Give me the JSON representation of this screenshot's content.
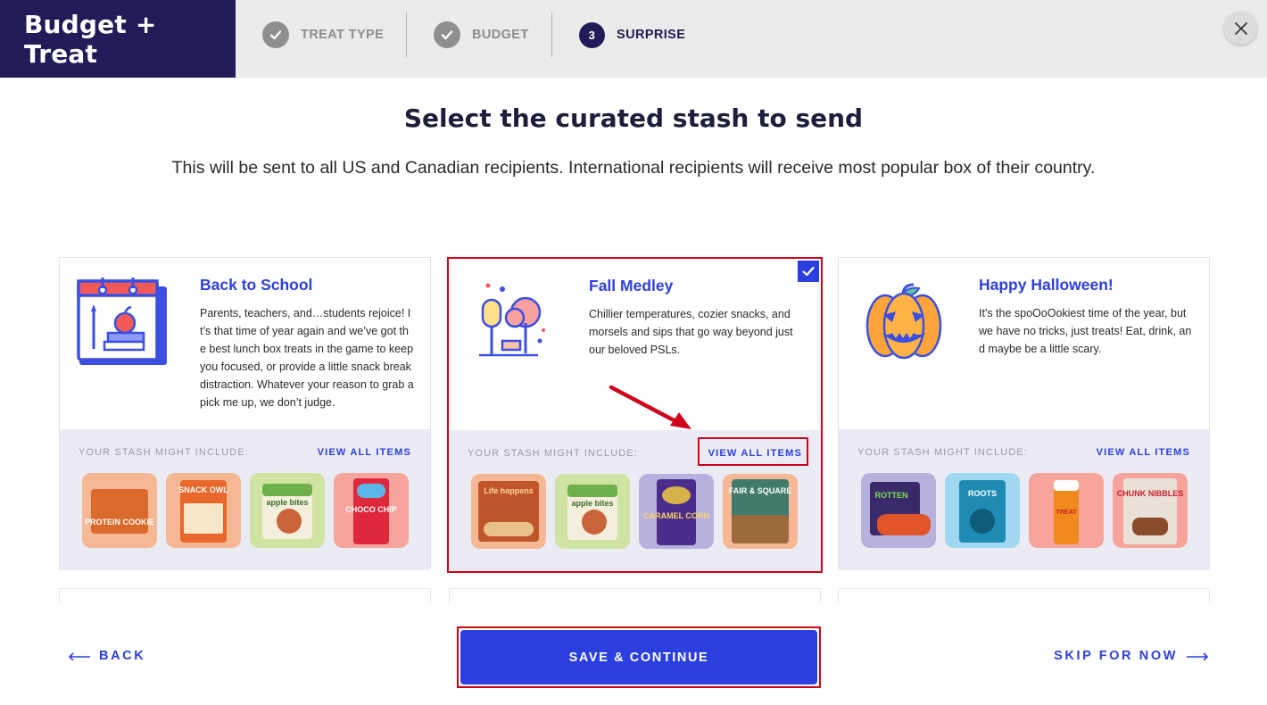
{
  "header": {
    "brand": "Budget + Treat",
    "steps": [
      {
        "label": "TREAT TYPE",
        "status": "done"
      },
      {
        "label": "BUDGET",
        "status": "done"
      },
      {
        "number": "3",
        "label": "SURPRISE",
        "status": "current"
      }
    ]
  },
  "main": {
    "title": "Select the curated stash to send",
    "subtitle": "This will be sent to all US and Canadian recipients. International recipients will receive most popular box of their country."
  },
  "cards": [
    {
      "name": "Back to School",
      "description": "Parents, teachers, and…students rejoice! It’s that time of year again and we’ve got the best lunch box treats in the game to keep you focused, or provide a little snack break distraction. Whatever your reason to grab a pick me up, we don’t judge.",
      "might_include": "YOUR STASH MIGHT INCLUDE:",
      "view_all": "VIEW ALL ITEMS",
      "selected": false,
      "items": [
        {
          "name": "protein-cookie",
          "bg": "#f6b894",
          "pack": "#d96a2b",
          "text": "PROTEIN COOKIE"
        },
        {
          "name": "kettle-chips",
          "bg": "#f6b894",
          "pack": "#e8672a",
          "text": "SNACK OWL"
        },
        {
          "name": "apple-bites",
          "bg": "#cfe4a2",
          "pack": "#6fb04a",
          "text": "apple bites"
        },
        {
          "name": "choco-chip-bar",
          "bg": "#f7a59c",
          "pack": "#e0283c",
          "text": "CHOCO CHIP"
        }
      ]
    },
    {
      "name": "Fall Medley",
      "description": "Chillier temperatures, cozier snacks, and morsels and sips that go way beyond just our beloved PSLs.",
      "might_include": "YOUR STASH MIGHT INCLUDE:",
      "view_all": "VIEW ALL ITEMS",
      "selected": true,
      "items": [
        {
          "name": "pecan-snack",
          "bg": "#f6b894",
          "pack": "#c0542a",
          "text": "Life happens"
        },
        {
          "name": "apple-bites",
          "bg": "#cfe4a2",
          "pack": "#6fb04a",
          "text": "apple bites"
        },
        {
          "name": "caramel-corn",
          "bg": "#b7b1de",
          "pack": "#4b2e8c",
          "text": "CARAMEL CORN"
        },
        {
          "name": "fair-square-cookies",
          "bg": "#f6b894",
          "pack": "#3f7a6b",
          "text": "FAIR & SQUARE"
        }
      ]
    },
    {
      "name": "Happy Halloween!",
      "description": "It's the spoOoOokiest time of the year, but we have no tricks, just treats! Eat, drink, and maybe be a little scary.",
      "might_include": "YOUR STASH MIGHT INCLUDE:",
      "view_all": "VIEW ALL ITEMS",
      "selected": false,
      "items": [
        {
          "name": "rotten-candy",
          "bg": "#b7b1de",
          "pack": "#3a2a6c",
          "text": "ROTTEN"
        },
        {
          "name": "licorice",
          "bg": "#9fd8f0",
          "pack": "#1f8bb5",
          "text": "ROOTS"
        },
        {
          "name": "candy-bar",
          "bg": "#f7a59c",
          "pack": "#f08a1c",
          "text": "TREAT"
        },
        {
          "name": "chunk-nibbles",
          "bg": "#f7a59c",
          "pack": "#e9e1d8",
          "text": "CHUNK NIBBLES"
        }
      ]
    }
  ],
  "footer": {
    "back": "BACK",
    "save": "SAVE & CONTINUE",
    "skip": "SKIP FOR NOW"
  },
  "colors": {
    "brand_bg": "#211c57",
    "accent": "#2b3fe0",
    "highlight": "#d0021b"
  }
}
